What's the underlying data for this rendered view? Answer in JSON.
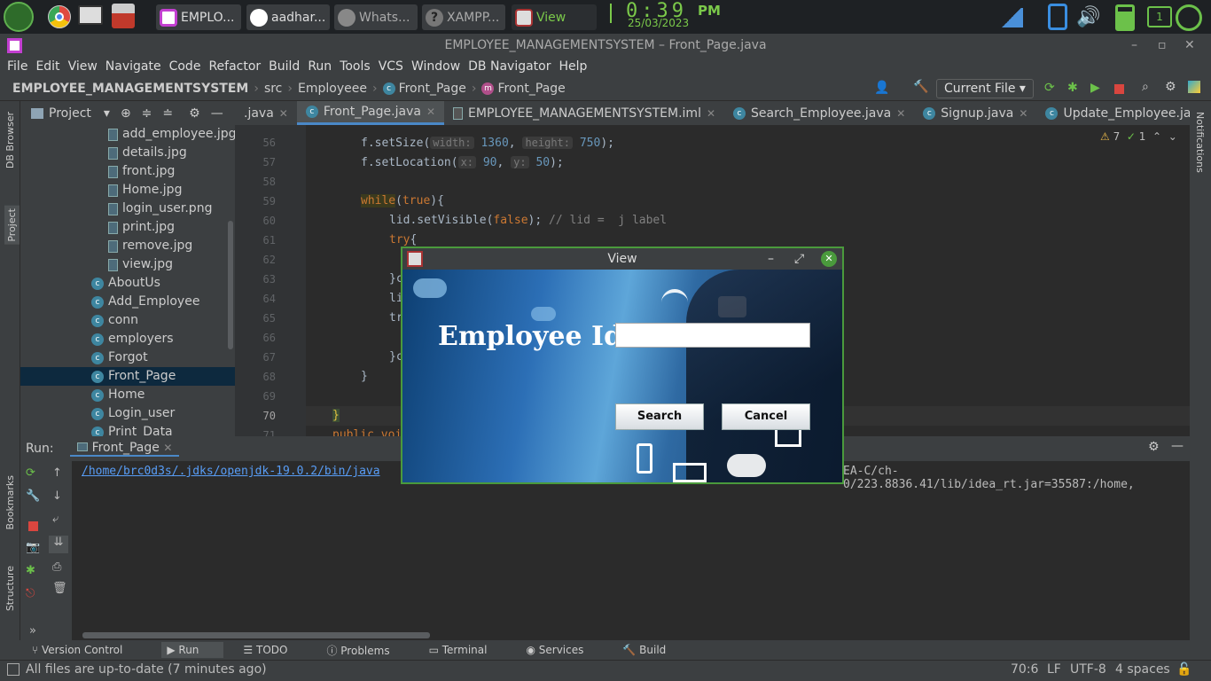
{
  "taskbar": {
    "apps": [
      {
        "label": "EMPLO..."
      },
      {
        "label": "aadhar..."
      },
      {
        "label": "Whats..."
      },
      {
        "label": "XAMPP..."
      },
      {
        "label": "View"
      }
    ],
    "clock": "0:39",
    "ampm": "PM",
    "date": "25/03/2023",
    "notification_count": "1"
  },
  "window": {
    "title": "EMPLOYEE_MANAGEMENTSYSTEM – Front_Page.java"
  },
  "menu": [
    "File",
    "Edit",
    "View",
    "Navigate",
    "Code",
    "Refactor",
    "Build",
    "Run",
    "Tools",
    "VCS",
    "Window",
    "DB Navigator",
    "Help"
  ],
  "breadcrumb": [
    "EMPLOYEE_MANAGEMENTSYSTEM",
    "src",
    "Employeee",
    "Front_Page",
    "Front_Page"
  ],
  "toolbar": {
    "run_config": "Current File"
  },
  "left_stripe": {
    "db_browser": "DB Browser",
    "project": "Project",
    "bookmarks": "Bookmarks",
    "structure": "Structure"
  },
  "right_stripe": {
    "notifications": "Notifications"
  },
  "project_panel": {
    "title": "Project",
    "items": [
      {
        "label": "add_employee.jpg",
        "kind": "file"
      },
      {
        "label": "details.jpg",
        "kind": "file"
      },
      {
        "label": "front.jpg",
        "kind": "file"
      },
      {
        "label": "Home.jpg",
        "kind": "file"
      },
      {
        "label": "login_user.png",
        "kind": "file"
      },
      {
        "label": "print.jpg",
        "kind": "file"
      },
      {
        "label": "remove.jpg",
        "kind": "file"
      },
      {
        "label": "view.jpg",
        "kind": "file"
      },
      {
        "label": "AboutUs",
        "kind": "class"
      },
      {
        "label": "Add_Employee",
        "kind": "class"
      },
      {
        "label": "conn",
        "kind": "class"
      },
      {
        "label": "employers",
        "kind": "class"
      },
      {
        "label": "Forgot",
        "kind": "class"
      },
      {
        "label": "Front_Page",
        "kind": "class",
        "selected": true
      },
      {
        "label": "Home",
        "kind": "class"
      },
      {
        "label": "Login_user",
        "kind": "class"
      },
      {
        "label": "Print_Data",
        "kind": "class"
      }
    ]
  },
  "editor": {
    "tabs": [
      {
        "label": ".java"
      },
      {
        "label": "Front_Page.java",
        "active": true
      },
      {
        "label": "EMPLOYEE_MANAGEMENTSYSTEM.iml"
      },
      {
        "label": "Search_Employee.java"
      },
      {
        "label": "Signup.java"
      },
      {
        "label": "Update_Employee.java"
      }
    ],
    "warnings": "7",
    "checks": "1",
    "line_numbers": [
      "56",
      "57",
      "58",
      "59",
      "60",
      "61",
      "62",
      "63",
      "64",
      "65",
      "66",
      "67",
      "68",
      "69",
      "70",
      "71"
    ],
    "code": {
      "l56_a": "f.setSize(",
      "l56_h1": "width:",
      "l56_v1": "1360",
      "l56_h2": "height:",
      "l56_v2": "750",
      "l56_end": ");",
      "l57_a": "f.setLocation(",
      "l57_h1": "x:",
      "l57_v1": "90",
      "l57_h2": "y:",
      "l57_v2": "50",
      "l57_end": ");",
      "l59_kw": "while",
      "l59_a": "(",
      "l59_kw2": "true",
      "l59_b": "){",
      "l60_a": "lid.setVisible(",
      "l60_kw": "false",
      "l60_b": ");",
      "l60_cm": "// lid =  j label",
      "l61_kw": "try",
      "l61_b": "{",
      "l63": "}c",
      "l64": "li",
      "l65": "tr",
      "l67": "}c",
      "l68": "}",
      "l70": "}",
      "l71": "public voi"
    }
  },
  "run_panel": {
    "label": "Run:",
    "config": "Front_Page",
    "output_link": "/home/brc0d3s/.jdks/openjdk-19.0.2/bin/java",
    "output_tail": "EA-C/ch-0/223.8836.41/lib/idea_rt.jar=35587:/home,"
  },
  "tool_windows": [
    "Version Control",
    "Run",
    "TODO",
    "Problems",
    "Terminal",
    "Services",
    "Build"
  ],
  "status": {
    "message": "All files are up-to-date (7 minutes ago)",
    "position": "70:6",
    "line_sep": "LF",
    "encoding": "UTF-8",
    "indent": "4 spaces"
  },
  "dialog": {
    "title": "View",
    "label": "Employee Id",
    "input_value": "",
    "search_button": "Search",
    "cancel_button": "Cancel"
  }
}
